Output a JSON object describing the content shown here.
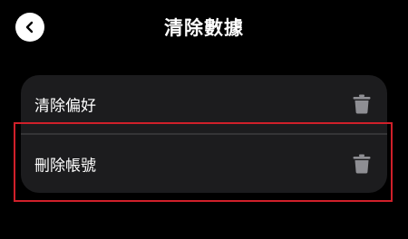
{
  "header": {
    "title": "清除數據",
    "back_icon": "chevron-left-icon"
  },
  "settings": {
    "items": [
      {
        "label": "清除偏好",
        "icon": "trash-icon"
      },
      {
        "label": "刪除帳號",
        "icon": "trash-icon"
      }
    ]
  },
  "colors": {
    "background": "#000000",
    "card": "#1c1c1e",
    "divider": "#343436",
    "text": "#ffffff",
    "icon": "#8e8e93",
    "highlight": "#d0202a"
  }
}
